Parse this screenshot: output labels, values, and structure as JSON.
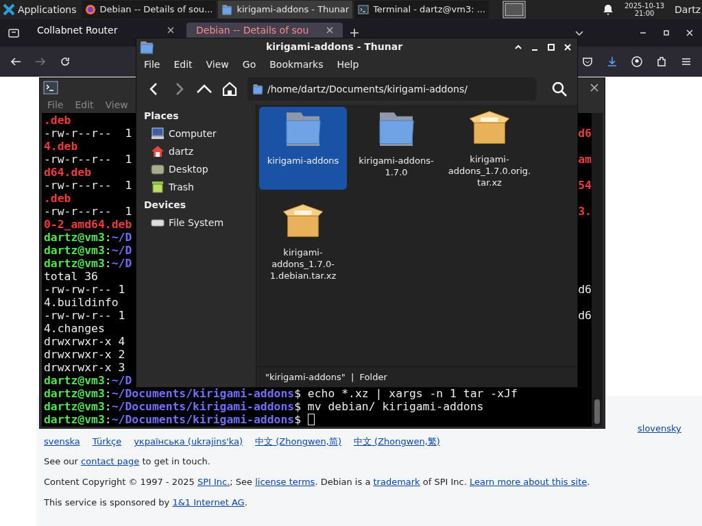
{
  "taskbar": {
    "launcher": "Applications",
    "tasks": [
      {
        "kind": "browser",
        "label": "Debian -- Details of sou...",
        "selected": false
      },
      {
        "kind": "files",
        "label": "kirigami-addons - Thunar",
        "selected": true
      },
      {
        "kind": "terminal",
        "label": "Terminal - dartz@vm3: ...",
        "selected": false
      }
    ],
    "date": "2025-10-13",
    "time": "21:00",
    "user": "Dartz"
  },
  "browser": {
    "tabs": [
      {
        "title": "Collabnet Router",
        "selected": false
      },
      {
        "title": "Debian -- Details of sou",
        "selected": true
      }
    ],
    "page": {
      "language_links": [
        [
          "slovensky"
        ],
        [
          "svenska",
          "Türkçe",
          "українська (ukrajins'ka)",
          "中文 (Zhongwen,简)",
          "中文 (Zhongwen,繁)"
        ]
      ],
      "sentences": [
        [
          {
            "text": "See our ",
            "link": false
          },
          {
            "text": "contact page",
            "link": true
          },
          {
            "text": " to get in touch.",
            "link": false
          }
        ],
        [
          {
            "text": "Content Copyright © 1997 - 2025 ",
            "link": false
          },
          {
            "text": "SPI Inc.",
            "link": true
          },
          {
            "text": "; See ",
            "link": false
          },
          {
            "text": "license terms",
            "link": true
          },
          {
            "text": ". Debian is a ",
            "link": false
          },
          {
            "text": "trademark",
            "link": true
          },
          {
            "text": " of SPI Inc. ",
            "link": false
          },
          {
            "text": "Learn more about this site",
            "link": true
          },
          {
            "text": ".",
            "link": false
          }
        ],
        [
          {
            "text": "This service is sponsored by ",
            "link": false
          },
          {
            "text": "1&1 Internet AG",
            "link": true
          },
          {
            "text": ".",
            "link": false
          }
        ]
      ]
    }
  },
  "terminal": {
    "menu": [
      "File",
      "Edit",
      "View"
    ],
    "lines": [
      {
        "segments": [
          {
            "text": ".deb",
            "kind": "error"
          }
        ]
      },
      {
        "segments": [
          {
            "text": "-rw-r--r--  1",
            "kind": "plain"
          }
        ],
        "right": {
          "text": "d6",
          "kind": "error"
        }
      },
      {
        "segments": [
          {
            "text": "4.deb",
            "kind": "error"
          }
        ]
      },
      {
        "segments": [
          {
            "text": "-rw-r--r--  1",
            "kind": "plain"
          }
        ],
        "right": {
          "text": "am",
          "kind": "error"
        }
      },
      {
        "segments": [
          {
            "text": "d64.deb",
            "kind": "error"
          }
        ]
      },
      {
        "segments": [
          {
            "text": "-rw-r--r--  1",
            "kind": "plain"
          }
        ],
        "right": {
          "text": "54",
          "kind": "error"
        }
      },
      {
        "segments": [
          {
            "text": ".deb",
            "kind": "error"
          }
        ]
      },
      {
        "segments": [
          {
            "text": "-rw-r--r--  1",
            "kind": "plain"
          }
        ],
        "right": {
          "text": "3.",
          "kind": "error"
        }
      },
      {
        "segments": [
          {
            "text": "0-2_amd64.deb",
            "kind": "error"
          }
        ]
      },
      {
        "segments": [
          {
            "text": "dartz@vm3",
            "kind": "user"
          },
          {
            "text": ":",
            "kind": "plain"
          },
          {
            "text": "~/D",
            "kind": "path"
          }
        ]
      },
      {
        "segments": [
          {
            "text": "dartz@vm3",
            "kind": "user"
          },
          {
            "text": ":",
            "kind": "plain"
          },
          {
            "text": "~/D",
            "kind": "path"
          }
        ]
      },
      {
        "segments": [
          {
            "text": "dartz@vm3",
            "kind": "user"
          },
          {
            "text": ":",
            "kind": "plain"
          },
          {
            "text": "~/D",
            "kind": "path"
          }
        ]
      },
      {
        "segments": [
          {
            "text": "total 36",
            "kind": "plain"
          }
        ]
      },
      {
        "segments": [
          {
            "text": "-rw-rw-r-- 1",
            "kind": "plain"
          }
        ],
        "right": {
          "text": "d6",
          "kind": "plain"
        }
      },
      {
        "segments": [
          {
            "text": "4.buildinfo",
            "kind": "plain"
          }
        ]
      },
      {
        "segments": [
          {
            "text": "-rw-rw-r-- 1",
            "kind": "plain"
          }
        ],
        "right": {
          "text": "d6",
          "kind": "plain"
        }
      },
      {
        "segments": [
          {
            "text": "4.changes",
            "kind": "plain"
          }
        ]
      },
      {
        "segments": [
          {
            "text": "drwxrwxr-x 4",
            "kind": "plain"
          }
        ]
      },
      {
        "segments": [
          {
            "text": "drwxrwxr-x 2",
            "kind": "plain"
          }
        ]
      },
      {
        "segments": [
          {
            "text": "drwxrwxr-x 3",
            "kind": "plain"
          }
        ]
      },
      {
        "segments": [
          {
            "text": "dartz@vm3",
            "kind": "user"
          },
          {
            "text": ":",
            "kind": "plain"
          },
          {
            "text": "~/D",
            "kind": "path"
          }
        ]
      },
      {
        "segments": [
          {
            "text": "dartz@vm3",
            "kind": "user"
          },
          {
            "text": ":",
            "kind": "plain"
          },
          {
            "text": "~/Documents/kirigami-addons",
            "kind": "path"
          },
          {
            "text": "$ echo *.xz | xargs -n 1 tar -xJf",
            "kind": "plain"
          }
        ]
      },
      {
        "segments": [
          {
            "text": "dartz@vm3",
            "kind": "user"
          },
          {
            "text": ":",
            "kind": "plain"
          },
          {
            "text": "~/Documents/kirigami-addons",
            "kind": "path"
          },
          {
            "text": "$ mv debian/ kirigami-addons",
            "kind": "plain"
          }
        ]
      },
      {
        "segments": [
          {
            "text": "dartz@vm3",
            "kind": "user"
          },
          {
            "text": ":",
            "kind": "plain"
          },
          {
            "text": "~/Documents/kirigami-addons",
            "kind": "path"
          },
          {
            "text": "$ ",
            "kind": "plain"
          }
        ],
        "cursor": true
      }
    ]
  },
  "thunar": {
    "title": "kirigami-addons - Thunar",
    "menu": [
      "File",
      "Edit",
      "View",
      "Go",
      "Bookmarks",
      "Help"
    ],
    "location": "/home/dartz/Documents/kirigami-addons/",
    "sidebar": [
      {
        "heading": "Places",
        "items": [
          {
            "label": "Computer",
            "kind": "computer"
          },
          {
            "label": "dartz",
            "kind": "home"
          },
          {
            "label": "Desktop",
            "kind": "desktop"
          },
          {
            "label": "Trash",
            "kind": "trash"
          }
        ]
      },
      {
        "heading": "Devices",
        "items": [
          {
            "label": "File System",
            "kind": "drive"
          }
        ]
      }
    ],
    "files": [
      {
        "name": "kirigami-addons",
        "kind": "folder",
        "selected": true
      },
      {
        "name": "kirigami-addons-1.7.0",
        "kind": "folder",
        "selected": false
      },
      {
        "name": "kirigami-addons_1.7.0.orig.tar.xz",
        "kind": "archive",
        "selected": false
      },
      {
        "name": "kirigami-addons_1.7.0-1.debian.tar.xz",
        "kind": "archive",
        "selected": false
      }
    ],
    "status": "\"kirigami-addons\"  |  Folder"
  }
}
